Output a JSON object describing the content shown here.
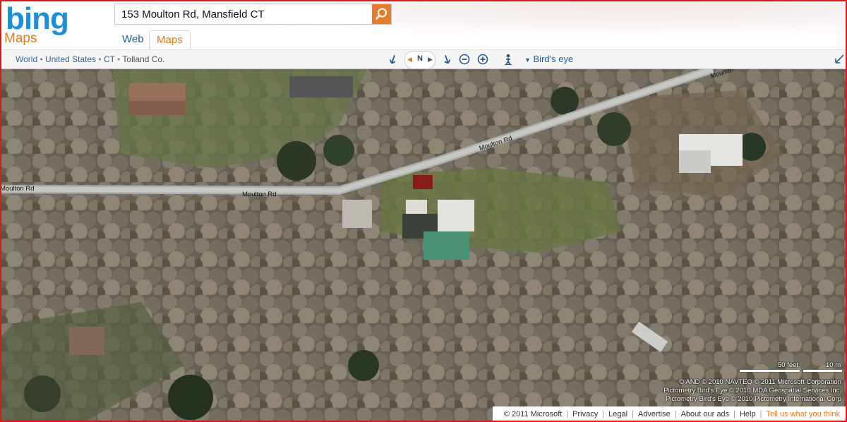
{
  "header": {
    "logo": "bing",
    "product": "Maps",
    "search_value": "153 Moulton Rd, Mansfield CT",
    "tabs": [
      "Web",
      "Maps"
    ],
    "active_tab": "Maps",
    "accent_color": "#e07a1f",
    "brand_color": "#1d8fd8"
  },
  "toolbar": {
    "breadcrumb": [
      "World",
      "United States",
      "CT",
      "Tolland Co."
    ],
    "compass_label": "N",
    "view_mode": "Bird's eye",
    "icons": [
      "rotate-left-icon",
      "compass-icon",
      "rotate-right-icon",
      "zoom-out-icon",
      "zoom-in-icon",
      "streetside-person-icon",
      "dropdown-arrow-icon",
      "collapse-icon"
    ]
  },
  "map": {
    "road_labels": [
      "Moulton Rd",
      "Moulton Rd",
      "Moulton Rd",
      "Moulton"
    ],
    "scale": {
      "feet": "50 feet",
      "meters": "10 m"
    },
    "attribution": [
      "© AND  © 2010 NAVTEQ  © 2011 Microsoft Corporation",
      "Pictometry Bird's Eye © 2010 MDA Geospatial Services Inc.",
      "Pictometry Bird's Eye © 2010 Pictometry International Corp"
    ]
  },
  "footer": {
    "copyright": "© 2011 Microsoft",
    "links": [
      "Privacy",
      "Legal",
      "Advertise",
      "About our ads",
      "Help"
    ],
    "feedback": "Tell us what you think"
  }
}
